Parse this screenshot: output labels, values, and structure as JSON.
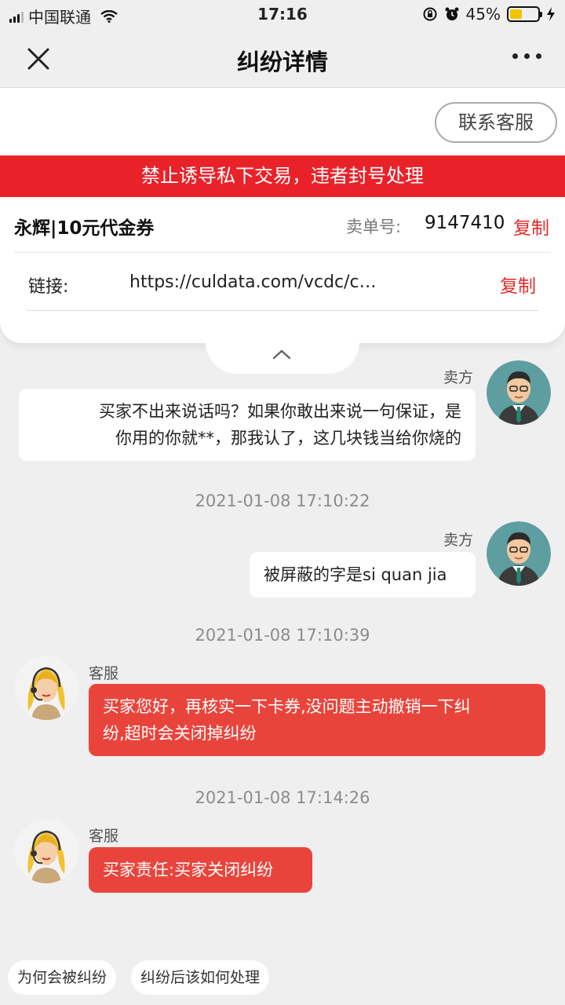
{
  "status_bar": {
    "carrier": "中国联通",
    "time": "17:16",
    "battery_percent": "45%",
    "battery_level": 0.45,
    "icons": [
      "signal-icon",
      "wifi-icon",
      "rotation-lock-icon",
      "alarm-icon",
      "battery-icon",
      "charging-icon"
    ]
  },
  "nav": {
    "title": "纠纷详情",
    "close_icon": "close-icon",
    "more_icon": "more-dots-icon"
  },
  "actions": {
    "contact_service": "联系客服"
  },
  "warning": "禁止诱导私下交易，违者封号处理",
  "order": {
    "name": "永辉|10元代金券",
    "no_label": "卖单号:",
    "no": "9147410",
    "copy": "复制",
    "link_label": "链接:",
    "link_value": "https://culdata.com/vcdc/c…",
    "link_copy": "复制"
  },
  "messages": [
    {
      "sender": "卖方",
      "text_lines": [
        "买家不出来说话吗？如果你敢出来说一句保证，是",
        "你用的你就**，那我认了，这几块钱当给你烧的"
      ]
    },
    {
      "timestamp": "2021-01-08 17:10:22"
    },
    {
      "sender": "卖方",
      "text": "被屏蔽的字是si quan jia"
    },
    {
      "timestamp": "2021-01-08 17:10:39"
    },
    {
      "sender": "客服",
      "text_lines": [
        "买家您好，再核实一下卡券,没问题主动撤销一下纠",
        "纷,超时会关闭掉纠纷"
      ]
    },
    {
      "timestamp": "2021-01-08 17:14:26"
    },
    {
      "sender": "客服",
      "text": "买家责任:买家关闭纠纷"
    }
  ],
  "quick_replies": [
    "为何会被纠纷",
    "纠纷后该如何处理"
  ],
  "colors": {
    "accent_red": "#e9222a",
    "bubble_red": "#e9443b",
    "copy_red": "#e52a2a",
    "background": "#efefef"
  }
}
